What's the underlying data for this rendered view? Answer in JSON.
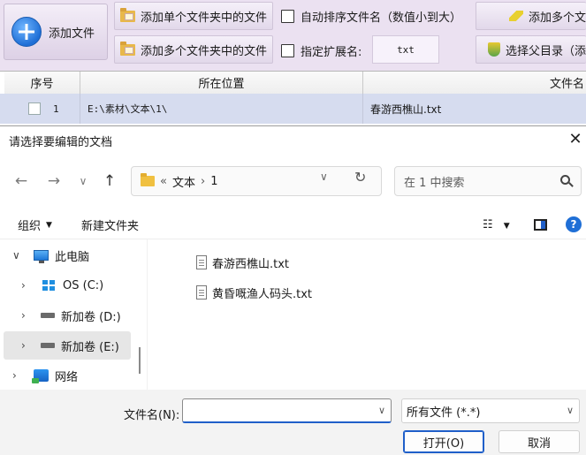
{
  "app": {
    "toolbar": {
      "add_file": "添加文件",
      "add_single_folder": "添加单个文件夹中的文件",
      "add_multi_folder": "添加多个文件夹中的文件",
      "auto_sort": "自动排序文件名（数值小到大）",
      "ext_label": "指定扩展名:",
      "ext_value": "txt",
      "add_multi_right": "添加多个文",
      "select_parent": "选择父目录（添"
    },
    "grid": {
      "headers": [
        "序号",
        "所在位置",
        "文件名"
      ],
      "rows": [
        {
          "index": "1",
          "location": "E:\\素材\\文本\\1\\",
          "filename": "春游西樵山.txt"
        }
      ]
    }
  },
  "dialog": {
    "title": "请选择要编辑的文档",
    "close": "✕",
    "nav": {
      "back": "←",
      "forward": "→",
      "recent": "∨",
      "up": "↑",
      "dropdown": "∨",
      "refresh": "↻"
    },
    "address": {
      "overflow": "«",
      "crumbs": [
        "文本",
        "1"
      ],
      "sep": "›"
    },
    "search_placeholder": "在 1 中搜索",
    "commands": {
      "organize": "组织",
      "new_folder": "新建文件夹",
      "view": "☷",
      "help": "?"
    },
    "tree": [
      {
        "label": "此电脑",
        "chevron": "∨"
      },
      {
        "label": "OS (C:)",
        "chevron": "›"
      },
      {
        "label": "新加卷 (D:)",
        "chevron": "›"
      },
      {
        "label": "新加卷 (E:)",
        "chevron": "›"
      },
      {
        "label": "网络",
        "chevron": "›"
      }
    ],
    "files": [
      "春游西樵山.txt",
      "黄昏嘅渔人码头.txt"
    ],
    "filename_label": "文件名(N):",
    "filename_value": "",
    "filetype": "所有文件 (*.*)",
    "open_button": "打开(O)",
    "cancel_button": "取消"
  },
  "colors": {
    "toolbar_bg": "#ebe1f1",
    "row_selected": "#d6dcef",
    "accent": "#1f5fc9"
  }
}
